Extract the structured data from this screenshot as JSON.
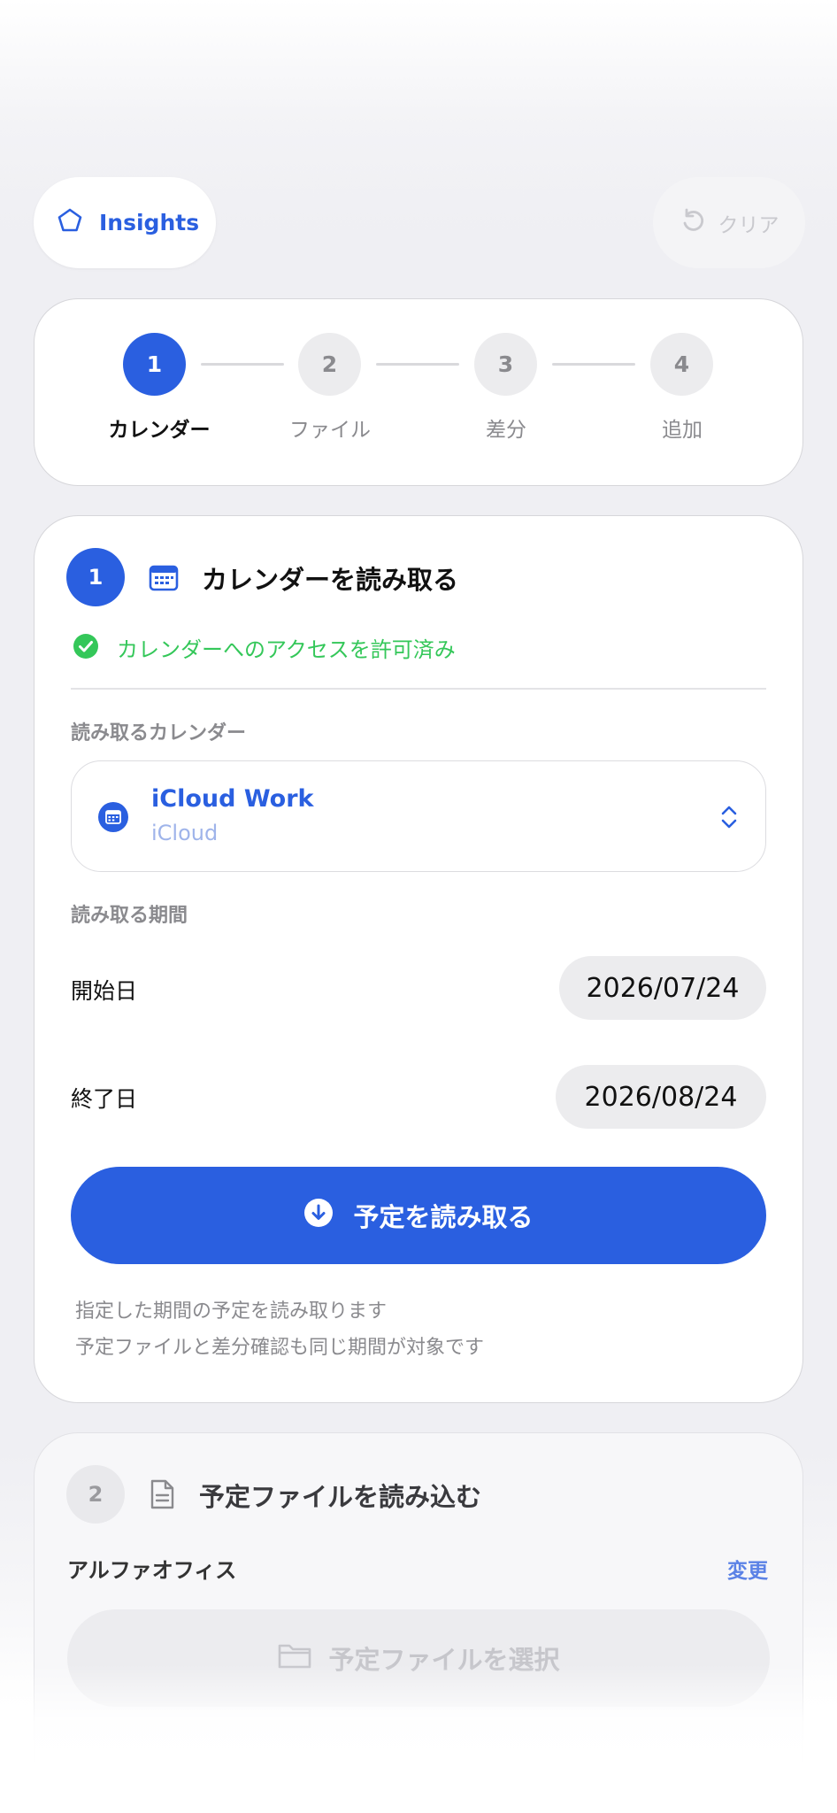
{
  "top_bar": {
    "insights_label": "Insights",
    "insights_icon": "pentagon-icon",
    "clear_label": "クリア",
    "clear_icon": "undo-icon"
  },
  "stepper": {
    "steps": [
      {
        "number": "1",
        "label": "カレンダー",
        "active": true
      },
      {
        "number": "2",
        "label": "ファイル",
        "active": false
      },
      {
        "number": "3",
        "label": "差分",
        "active": false
      },
      {
        "number": "4",
        "label": "追加",
        "active": false
      }
    ]
  },
  "calendar_section": {
    "number": "1",
    "title": "カレンダーを読み取る",
    "icon": "calendar-icon",
    "access_status": "カレンダーへのアクセスを許可済み",
    "calendar_field_label": "読み取るカレンダー",
    "selected_calendar": {
      "name": "iCloud Work",
      "account": "iCloud"
    },
    "period_label": "読み取る期間",
    "start_label": "開始日",
    "start_date": "2026/07/24",
    "end_label": "終了日",
    "end_date": "2026/08/24",
    "read_button": "予定を読み取る",
    "note_line1": "指定した期間の予定を読み取ります",
    "note_line2": "予定ファイルと差分確認も同じ期間が対象です"
  },
  "file_section": {
    "number": "2",
    "title": "予定ファイルを読み込む",
    "icon": "document-icon",
    "office_label": "アルファオフィス",
    "change_label": "変更",
    "select_button": "予定ファイルを選択"
  },
  "colors": {
    "accent": "#2a5fe0",
    "success": "#34c759",
    "muted": "#8a8a8e"
  }
}
